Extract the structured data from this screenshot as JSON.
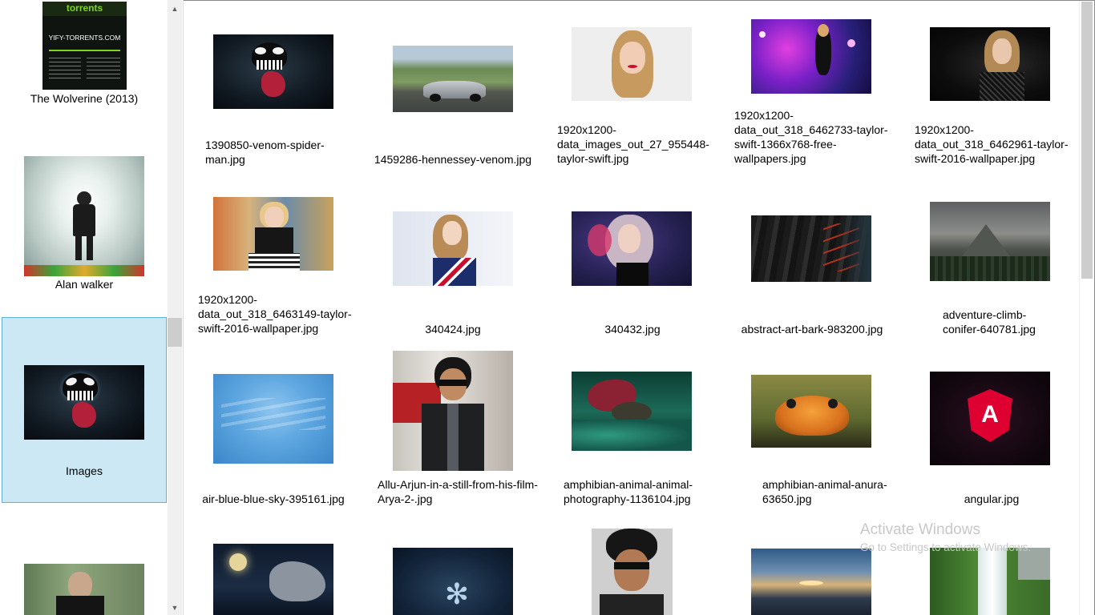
{
  "sidebar": {
    "folders": [
      {
        "label": "The Wolverine (2013)",
        "poster_text": [
          "YIFY-TORRENTS.COM",
          "torrents"
        ]
      },
      {
        "label": "Alan walker"
      },
      {
        "label": "Images"
      },
      {
        "label": ""
      }
    ]
  },
  "images": [
    {
      "caption": "1390850-venom-spider-man.jpg"
    },
    {
      "caption": "1459286-hennessey-venom.jpg"
    },
    {
      "caption": "1920x1200-data_images_out_27_955448-taylor-swift.jpg"
    },
    {
      "caption": "1920x1200-data_out_318_6462733-taylor-swift-1366x768-free-wallpapers.jpg"
    },
    {
      "caption": "1920x1200-data_out_318_6462961-taylor-swift-2016-wallpaper.jpg"
    },
    {
      "caption": "1920x1200-data_out_318_6463149-taylor-swift-2016-wallpaper.jpg"
    },
    {
      "caption": "340424.jpg"
    },
    {
      "caption": "340432.jpg"
    },
    {
      "caption": "abstract-art-bark-983200.jpg"
    },
    {
      "caption": "adventure-climb-conifer-640781.jpg"
    },
    {
      "caption": "air-blue-blue-sky-395161.jpg"
    },
    {
      "caption": "Allu-Arjun-in-a-still-from-his-film-Arya-2-.jpg"
    },
    {
      "caption": "amphibian-animal-animal-photography-1136104.jpg"
    },
    {
      "caption": "amphibian-animal-anura-63650.jpg"
    },
    {
      "caption": "angular.jpg"
    }
  ],
  "watermark": {
    "line1": "Activate Windows",
    "line2": "Go to Settings to activate Windows."
  },
  "colors": {
    "selected_bg": "#cce8f4",
    "selected_border": "#5fb2dd",
    "scrollbar_thumb": "#cdcdcd"
  }
}
